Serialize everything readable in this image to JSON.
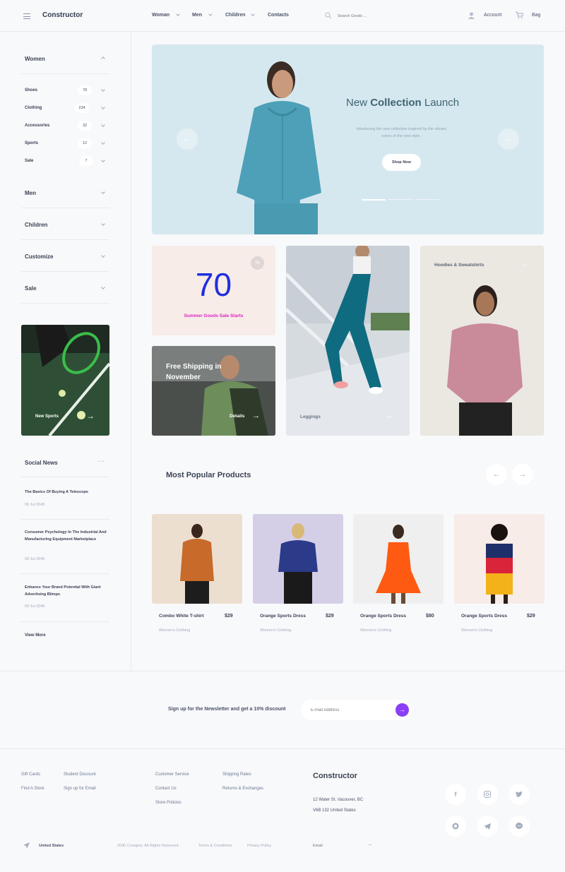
{
  "header": {
    "brand": "Constructor",
    "nav": [
      "Woman",
      "Men",
      "Children",
      "Contacts"
    ],
    "search_placeholder": "Search Goods ...",
    "account": "Account",
    "bag": "Bag"
  },
  "sidebar": {
    "women": {
      "title": "Women",
      "items": [
        {
          "label": "Shoes",
          "count": "78"
        },
        {
          "label": "Clothing",
          "count": "234"
        },
        {
          "label": "Accessories",
          "count": "32"
        },
        {
          "label": "Sports",
          "count": "12"
        },
        {
          "label": "Sale",
          "count": "7"
        }
      ]
    },
    "groups": [
      "Men",
      "Children",
      "Customize",
      "Sale"
    ],
    "promo_label": "New Sports",
    "social_news": {
      "title": "Social News",
      "items": [
        {
          "title": "The Basics Of Buying A Telescope",
          "date": "09 Jul 2045"
        },
        {
          "title": "Consumer Psychology In The Industrial And Manufacturing Equipment Marketplace",
          "date": "09 Jul 2045"
        },
        {
          "title": "Enhance Your Brand Potential With Giant Advertising Blimps",
          "date": "09 Jul 2045"
        }
      ],
      "view_more": "View More"
    }
  },
  "hero": {
    "title_pre": "New ",
    "title_bold": "Collection",
    "title_post": " Launch",
    "subtitle": "Introducing the new collection inspired by the vibrant colors of the new style.",
    "cta": "Shop Now"
  },
  "promos": {
    "sale_number": "70",
    "sale_text": "Summer Goods Sale Starts",
    "shipping_title": "Free Shipping in November",
    "shipping_cta": "Details",
    "leggings": "Leggings",
    "hoodies": "Hoodies & Sweatshirts"
  },
  "popular": {
    "title": "Most Popular Products",
    "products": [
      {
        "name": "Combo White T-shirt",
        "price": "$29",
        "category": "Women's Clothing",
        "bg": "#ecdfd0"
      },
      {
        "name": "Orange Sports Dress",
        "price": "$29",
        "category": "Women's Clothing",
        "bg": "#d4cfe6"
      },
      {
        "name": "Orange Sports Dress",
        "price": "$80",
        "category": "Women's Clothing",
        "bg": "#efefef"
      },
      {
        "name": "Orange Sports Dress",
        "price": "$29",
        "category": "Women's Clothing",
        "bg": "#f7ece8"
      }
    ]
  },
  "newsletter": {
    "text": "Sign up for the Newsletter and get a 10% discount",
    "placeholder": "E-mail Address"
  },
  "footer": {
    "col1": [
      "Gift Cards",
      "Find A Store"
    ],
    "col2": [
      "Student Discount",
      "Sign up for Email"
    ],
    "col3": [
      "Customer Service",
      "Contact Us",
      "Store Policies"
    ],
    "col4": [
      "Shipping Rates",
      "Returns & Exchanges"
    ],
    "brand": "Constructor",
    "address1": "12 Water St. Vacouver, BC",
    "address2": "V6B 132 United States",
    "country": "United States",
    "copyright": "2030 Conapny. All Rights Reserved.",
    "terms": "Terms & Conditions",
    "privacy": "Privacy Policy",
    "email_placeholder": "Email"
  },
  "colors": {
    "accent": "#8a3ff5",
    "sale_blue": "#1f2ee0",
    "sale_pink": "#e020c8",
    "hero_bg": "#d6e8ef"
  }
}
